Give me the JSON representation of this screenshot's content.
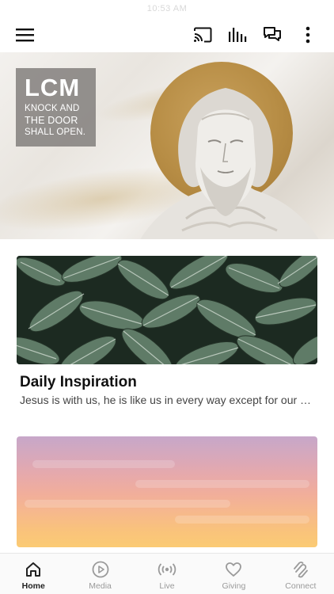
{
  "status_bar": {
    "time": "10:53 AM"
  },
  "topbar": {
    "icons": [
      "menu-icon",
      "cast-icon",
      "audio-bars-icon",
      "chat-icon",
      "more-vertical-icon"
    ]
  },
  "hero": {
    "logo_title": "LCM",
    "logo_tagline_1": "KNOCK AND",
    "logo_tagline_2": "THE DOOR",
    "logo_tagline_3": "SHALL OPEN."
  },
  "cards": [
    {
      "title": "Daily Inspiration",
      "subtitle": "Jesus is with us, he is like us in every way except for our sin"
    },
    {
      "title": "",
      "subtitle": ""
    }
  ],
  "bottom_nav": {
    "items": [
      {
        "label": "Home",
        "icon": "home-icon",
        "active": true
      },
      {
        "label": "Media",
        "icon": "play-circle-icon",
        "active": false
      },
      {
        "label": "Live",
        "icon": "broadcast-icon",
        "active": false
      },
      {
        "label": "Giving",
        "icon": "heart-icon",
        "active": false
      },
      {
        "label": "Connect",
        "icon": "connect-icon",
        "active": false
      }
    ]
  },
  "colors": {
    "active": "#222222",
    "inactive": "#9a9a9a",
    "halo": "#b78d45"
  }
}
